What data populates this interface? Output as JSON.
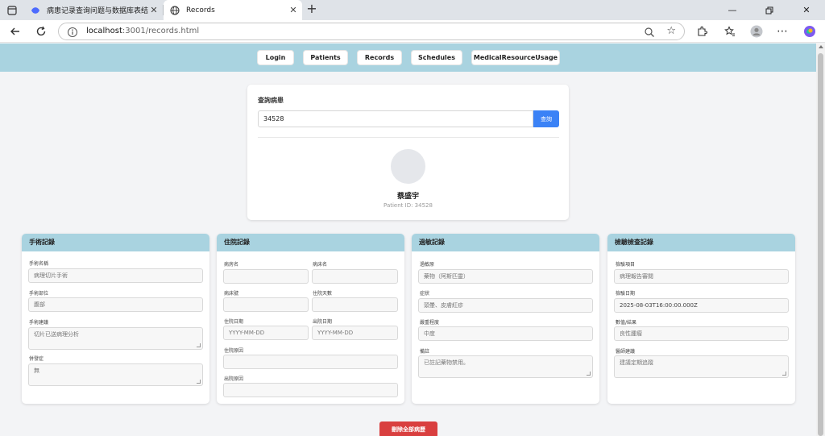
{
  "browser": {
    "tabs": [
      {
        "title": "病患记录查询问题与数据库表结构",
        "active": false
      },
      {
        "title": "Records",
        "active": true
      }
    ],
    "url_host": "localhost",
    "url_rest": ":3001/records.html"
  },
  "nav": {
    "items": [
      "Login",
      "Patients",
      "Records",
      "Schedules",
      "MedicalResourceUsage"
    ]
  },
  "query": {
    "title": "查詢病患",
    "input_value": "34528",
    "button_label": "查詢",
    "patient_name": "蔡盛宇",
    "patient_id_label": "Patient ID: 34528"
  },
  "surgery": {
    "header": "手術記錄",
    "name_label": "手術名稱",
    "name_value": "病理切片手術",
    "site_label": "手術部位",
    "site_value": "腹部",
    "advice_label": "手術建議",
    "advice_value": "切片已送病理分析",
    "complication_label": "併發症",
    "complication_value": "無"
  },
  "hospitalization": {
    "header": "住院記錄",
    "ward_label": "病房名",
    "bed_label": "病床名",
    "bed_no_label": "病床號",
    "days_label": "住院天數",
    "admit_date_label": "住院日期",
    "admit_date_placeholder": "YYYY-MM-DD",
    "discharge_date_label": "出院日期",
    "discharge_date_placeholder": "YYYY-MM-DD",
    "admit_reason_label": "住院原因",
    "discharge_reason_label": "出院原因"
  },
  "allergy": {
    "header": "過敏記錄",
    "allergen_label": "過敏原",
    "allergen_value": "藥物（阿斯匹靈）",
    "symptom_label": "症狀",
    "symptom_value": "頭暈、皮膚紅疹",
    "severity_label": "嚴重程度",
    "severity_value": "中度",
    "note_label": "備註",
    "note_value": "已註記藥物禁用。"
  },
  "lab": {
    "header": "檢驗檢查記錄",
    "item_label": "檢驗項目",
    "item_value": "病理報告審閱",
    "date_label": "檢驗日期",
    "date_value": "2025-08-03T16:00:00.000Z",
    "result_label": "數值/結果",
    "result_value": "良性腫瘤",
    "advice_label": "醫師建議",
    "advice_value": "建議定期追蹤"
  },
  "actions": {
    "delete_label": "刪除全部病歷"
  },
  "colors": {
    "nav_bg": "#a9d3e0",
    "query_button": "#3b82f6",
    "delete_button": "#d93f3f"
  }
}
